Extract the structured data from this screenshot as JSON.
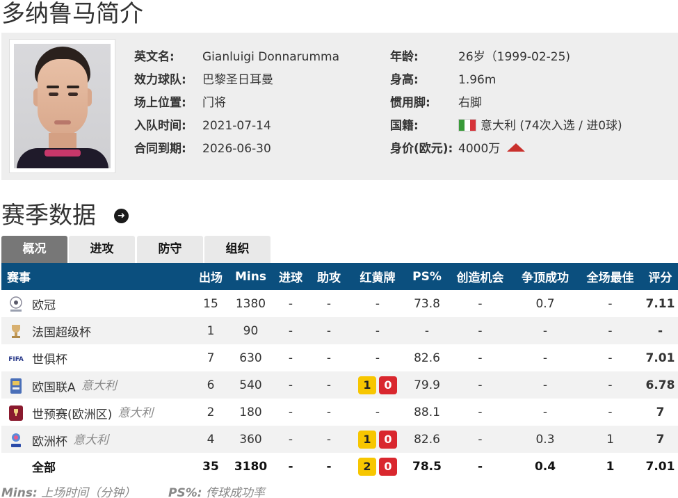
{
  "page_title": "多纳鲁马简介",
  "profile": {
    "left": [
      {
        "label": "英文名:",
        "value": "Gianluigi Donnarumma"
      },
      {
        "label": "效力球队:",
        "value": "巴黎圣日耳曼"
      },
      {
        "label": "场上位置:",
        "value": "门将"
      },
      {
        "label": "入队时间:",
        "value": "2021-07-14"
      },
      {
        "label": "合同到期:",
        "value": "2026-06-30"
      }
    ],
    "right": [
      {
        "label": "年龄:",
        "value": "26岁（1999-02-25)"
      },
      {
        "label": "身高:",
        "value": "1.96m"
      },
      {
        "label": "惯用脚:",
        "value": "右脚"
      },
      {
        "label": "国籍:",
        "value": "意大利 (74次入选 / 进0球)"
      },
      {
        "label": "身价(欧元):",
        "value": "4000万"
      }
    ]
  },
  "section_title": "赛季数据",
  "tabs": [
    "概况",
    "进攻",
    "防守",
    "组织"
  ],
  "active_tab": "概况",
  "table": {
    "headers": [
      "赛事",
      "出场",
      "Mins",
      "进球",
      "助攻",
      "红黄牌",
      "PS%",
      "创造机会",
      "争顶成功",
      "全场最佳",
      "评分"
    ],
    "rows": [
      {
        "icon": "champions-league-icon",
        "name": "欧冠",
        "team": "",
        "apps": "15",
        "mins": "1380",
        "goals": "-",
        "assists": "-",
        "yellow": "",
        "red": "",
        "cards": "-",
        "ps": "73.8",
        "chances": "-",
        "aerials": "0.7",
        "motm": "-",
        "rating": "7.11"
      },
      {
        "icon": "trophy-icon",
        "name": "法国超级杯",
        "team": "",
        "apps": "1",
        "mins": "90",
        "goals": "-",
        "assists": "-",
        "yellow": "",
        "red": "",
        "cards": "-",
        "ps": "-",
        "chances": "-",
        "aerials": "-",
        "motm": "-",
        "rating": "-"
      },
      {
        "icon": "fifa-icon",
        "name": "世俱杯",
        "team": "",
        "apps": "7",
        "mins": "630",
        "goals": "-",
        "assists": "-",
        "yellow": "",
        "red": "",
        "cards": "-",
        "ps": "82.6",
        "chances": "-",
        "aerials": "-",
        "motm": "-",
        "rating": "7.01"
      },
      {
        "icon": "nations-league-icon",
        "name": "欧国联A",
        "team": "意大利",
        "apps": "6",
        "mins": "540",
        "goals": "-",
        "assists": "-",
        "yellow": "1",
        "red": "0",
        "cards": "",
        "ps": "79.9",
        "chances": "-",
        "aerials": "-",
        "motm": "-",
        "rating": "6.78"
      },
      {
        "icon": "world-cup-qualifier-icon",
        "name": "世预赛(欧洲区)",
        "team": "意大利",
        "apps": "2",
        "mins": "180",
        "goals": "-",
        "assists": "-",
        "yellow": "",
        "red": "",
        "cards": "-",
        "ps": "88.1",
        "chances": "-",
        "aerials": "-",
        "motm": "-",
        "rating": "7"
      },
      {
        "icon": "euro-icon",
        "name": "欧洲杯",
        "team": "意大利",
        "apps": "4",
        "mins": "360",
        "goals": "-",
        "assists": "-",
        "yellow": "1",
        "red": "0",
        "cards": "",
        "ps": "82.6",
        "chances": "-",
        "aerials": "0.3",
        "motm": "1",
        "rating": "7"
      }
    ],
    "total": {
      "name": "全部",
      "apps": "35",
      "mins": "3180",
      "goals": "-",
      "assists": "-",
      "yellow": "2",
      "red": "0",
      "ps": "78.5",
      "chances": "-",
      "aerials": "0.4",
      "motm": "1",
      "rating": "7.01"
    }
  },
  "footnote": {
    "mins_key": "Mins:",
    "mins_desc": "上场时间（分钟）",
    "ps_key": "PS%:",
    "ps_desc": "传球成功率"
  },
  "colors": {
    "header_bg": "#0b4f7e",
    "rating": "#e8741a",
    "yellow_card": "#f7c600",
    "red_card": "#d9272e",
    "tab_active": "#777777"
  }
}
